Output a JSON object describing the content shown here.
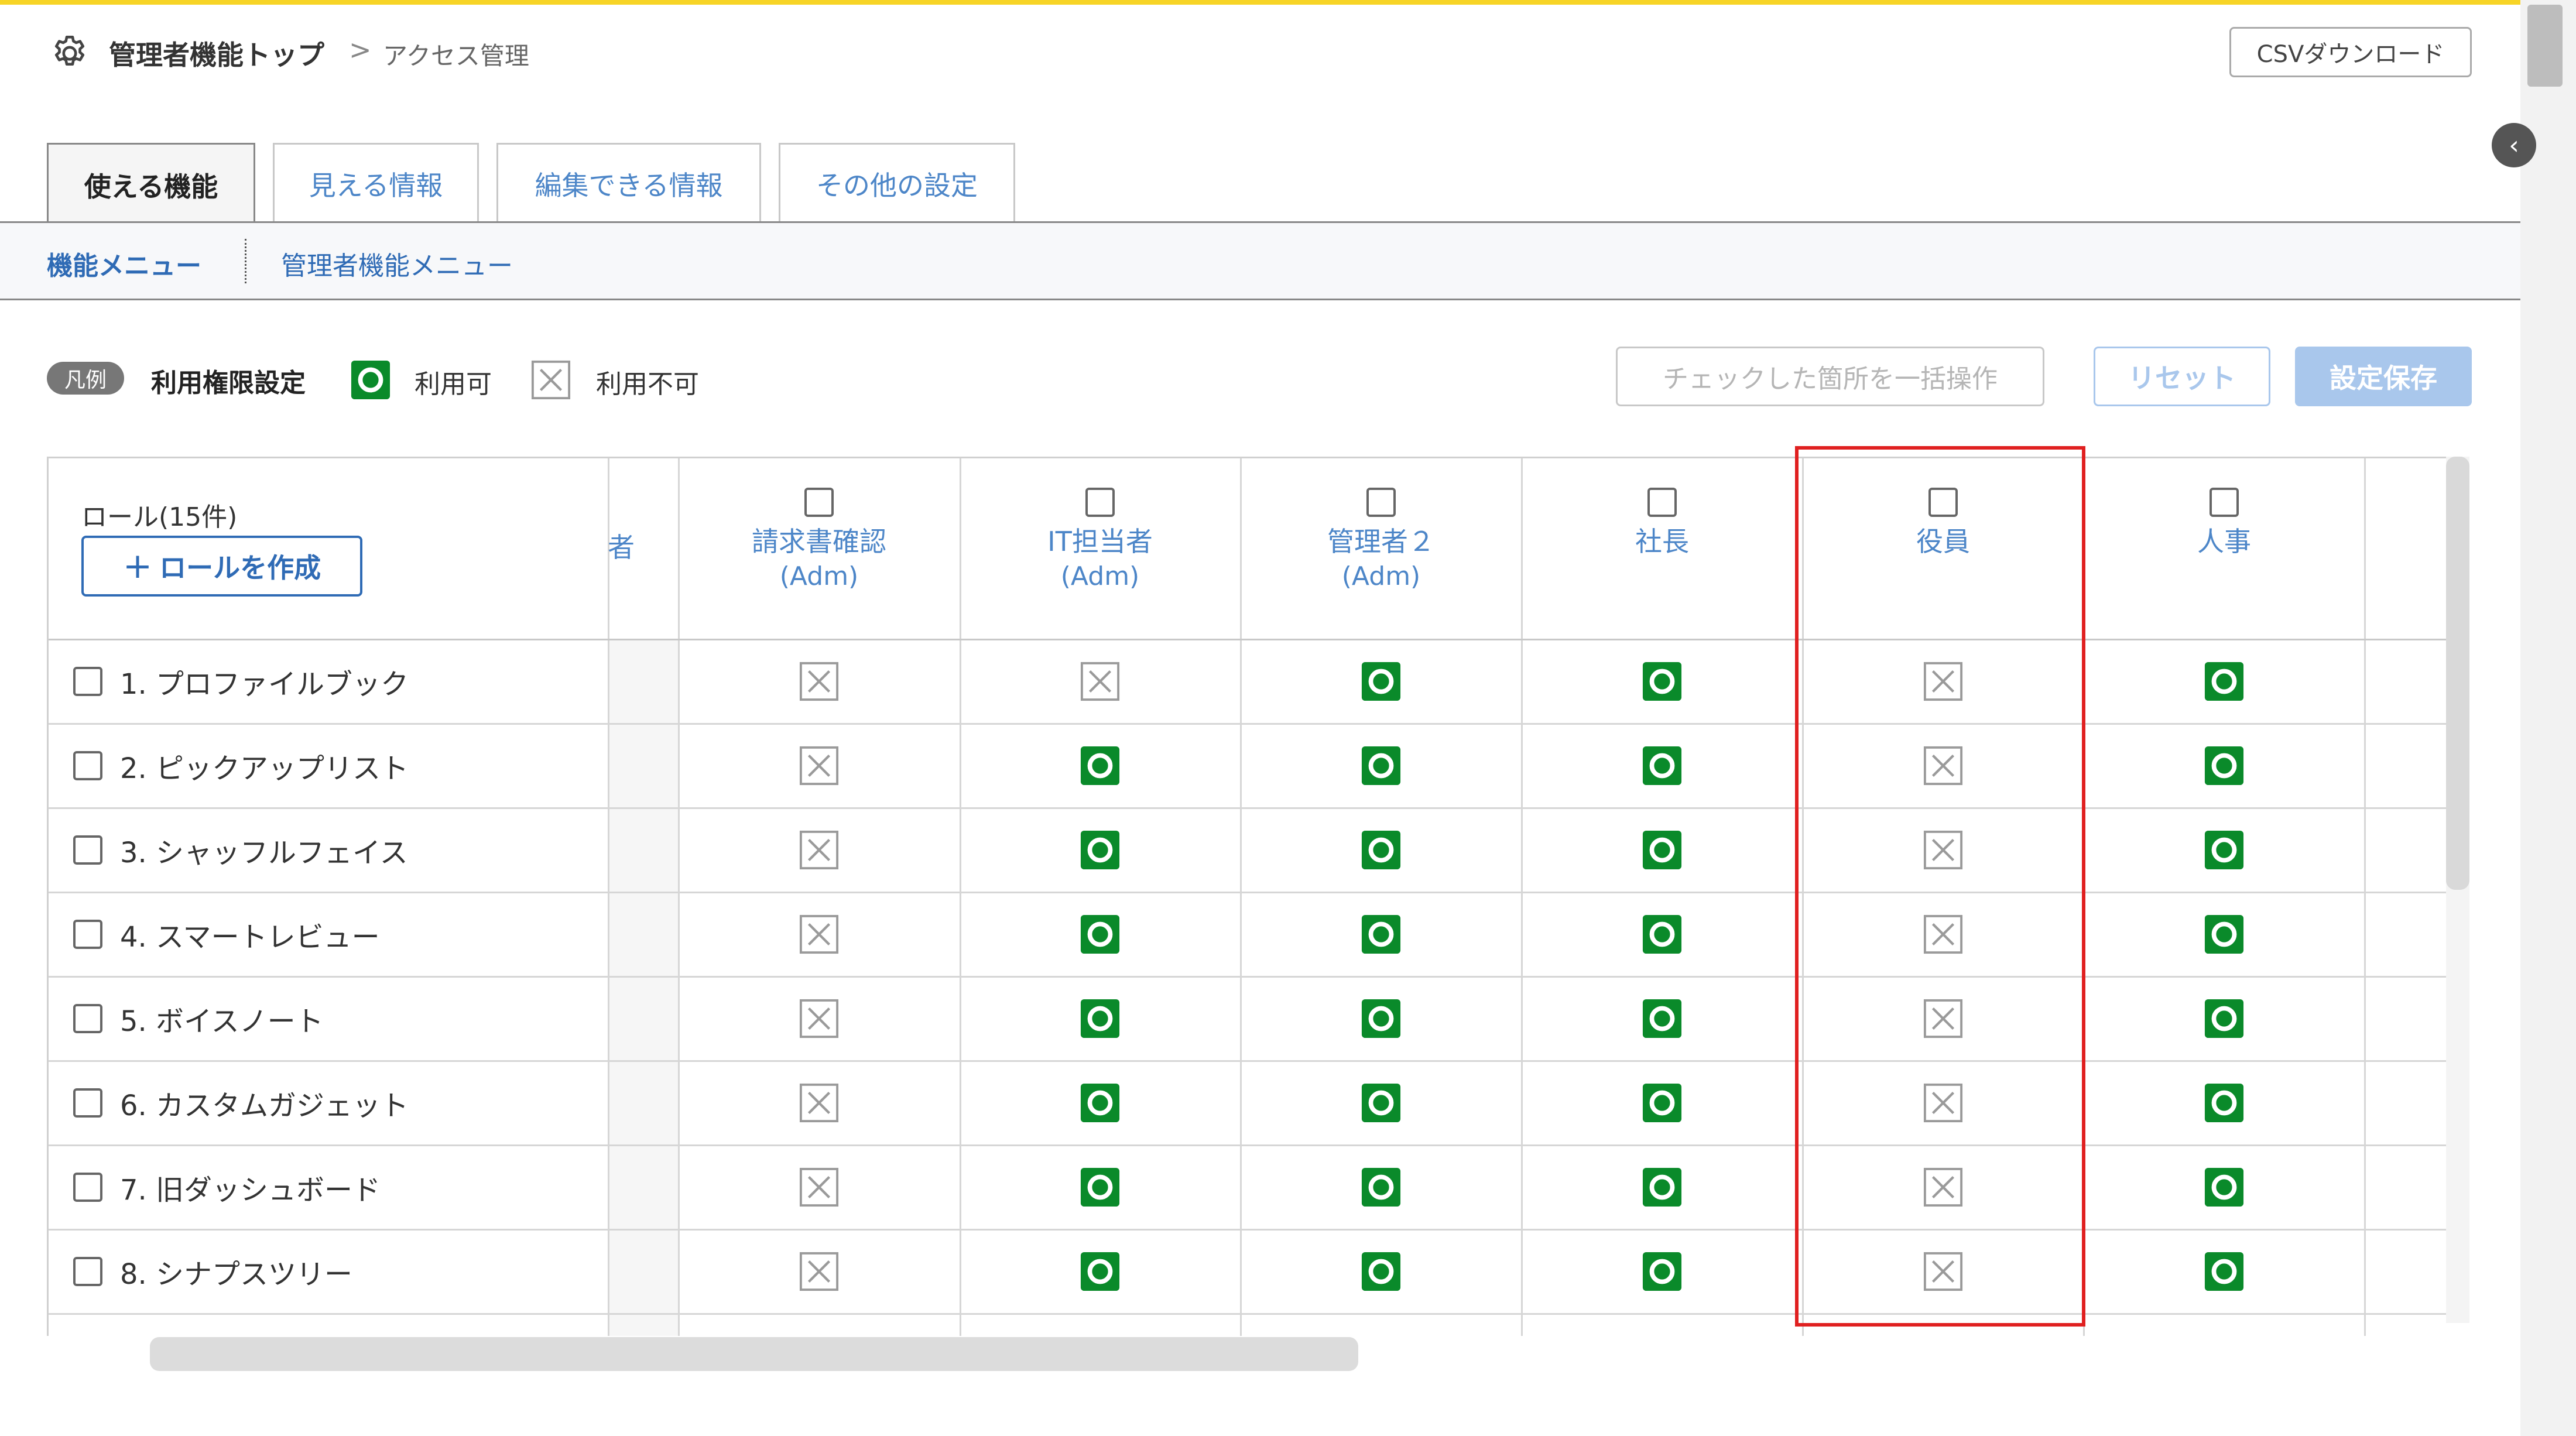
{
  "breadcrumb": {
    "home": "管理者機能トップ",
    "separator": ">",
    "current": "アクセス管理"
  },
  "header": {
    "csv_button": "CSVダウンロード",
    "collapse_glyph": "‹"
  },
  "tabs": [
    {
      "label": "使える機能",
      "active": true
    },
    {
      "label": "見える情報",
      "active": false
    },
    {
      "label": "編集できる情報",
      "active": false
    },
    {
      "label": "その他の設定",
      "active": false
    }
  ],
  "subnav": [
    "機能メニュー",
    "管理者機能メニュー"
  ],
  "legend": {
    "badge": "凡例",
    "title": "利用権限設定",
    "ok_label": "利用可",
    "ng_label": "利用不可"
  },
  "actions": {
    "bulk": "チェックした箇所を一括操作",
    "reset": "リセット",
    "save": "設定保存"
  },
  "table": {
    "role_count": "ロール(15件)",
    "create_role": "ロールを作成",
    "create_role_glyph": "+",
    "cut_column_text": "者",
    "columns": [
      {
        "name": "請求書確認",
        "sub": "(Adm)"
      },
      {
        "name": "IT担当者",
        "sub": "(Adm)"
      },
      {
        "name": "管理者２",
        "sub": "(Adm)"
      },
      {
        "name": "社長",
        "sub": ""
      },
      {
        "name": "役員",
        "sub": ""
      },
      {
        "name": "人事",
        "sub": ""
      }
    ],
    "rows": [
      {
        "label": "1. プロファイルブック",
        "perms": [
          false,
          false,
          true,
          true,
          false,
          true
        ]
      },
      {
        "label": "2. ピックアップリスト",
        "perms": [
          false,
          true,
          true,
          true,
          false,
          true
        ]
      },
      {
        "label": "3. シャッフルフェイス",
        "perms": [
          false,
          true,
          true,
          true,
          false,
          true
        ]
      },
      {
        "label": "4. スマートレビュー",
        "perms": [
          false,
          true,
          true,
          true,
          false,
          true
        ]
      },
      {
        "label": "5. ボイスノート",
        "perms": [
          false,
          true,
          true,
          true,
          false,
          true
        ]
      },
      {
        "label": "6. カスタムガジェット",
        "perms": [
          false,
          true,
          true,
          true,
          false,
          true
        ]
      },
      {
        "label": "7. 旧ダッシュボード",
        "perms": [
          false,
          true,
          true,
          true,
          false,
          true
        ]
      },
      {
        "label": "8. シナプスツリー",
        "perms": [
          false,
          true,
          true,
          true,
          false,
          true
        ]
      }
    ],
    "highlighted_column": "役員"
  },
  "colors": {
    "allowed": "#0a8a2a",
    "denied": "#9a9a9a",
    "accent": "#2f6bb5",
    "highlight": "#e02020",
    "top_bar": "#f7d426"
  },
  "icons": {
    "settings": "gear-icon",
    "allowed": "allowed-icon",
    "denied": "denied-icon"
  }
}
